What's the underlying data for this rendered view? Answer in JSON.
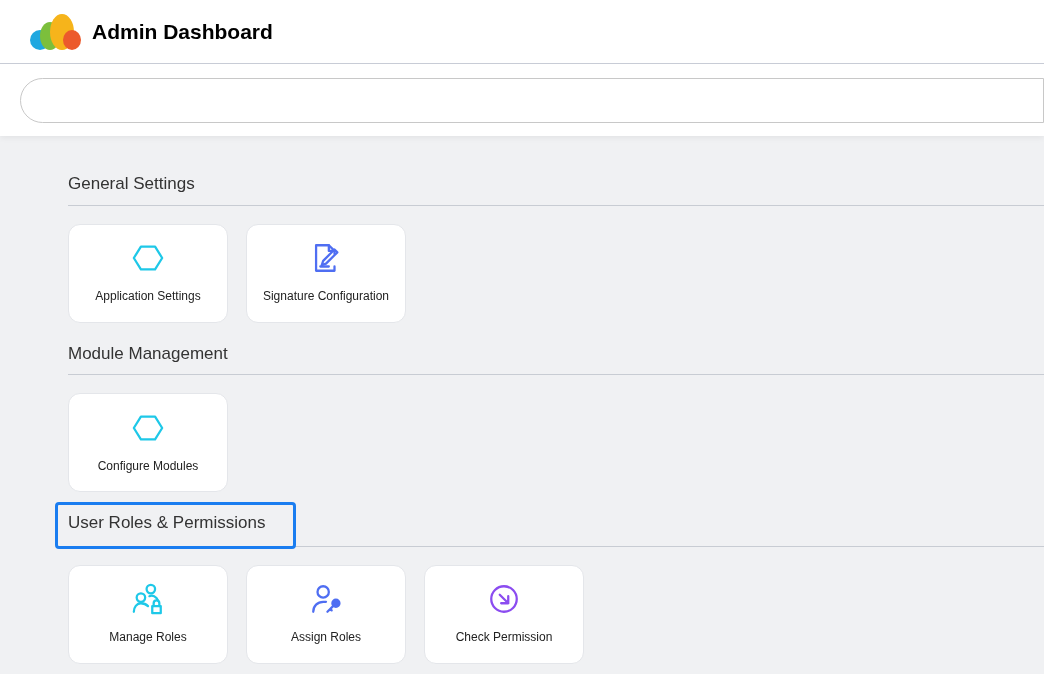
{
  "header": {
    "title": "Admin Dashboard"
  },
  "sections": [
    {
      "title": "General Settings",
      "highlighted": false,
      "tiles": [
        {
          "label": "Application Settings",
          "kind": "hexagon",
          "color": "#1ec8e8"
        },
        {
          "label": "Signature Configuration",
          "kind": "document-pen",
          "color": "#4f6ef2"
        }
      ]
    },
    {
      "title": "Module Management",
      "highlighted": false,
      "tiles": [
        {
          "label": "Configure Modules",
          "kind": "hexagon",
          "color": "#1ec8e8"
        }
      ]
    },
    {
      "title": "User Roles & Permissions",
      "highlighted": true,
      "tiles": [
        {
          "label": "Manage Roles",
          "kind": "users-lock",
          "color": "#1ec8e8"
        },
        {
          "label": "Assign Roles",
          "kind": "user-key",
          "color": "#4f6ef2"
        },
        {
          "label": "Check Permission",
          "kind": "arrow-circle",
          "color": "#8b4cf0"
        }
      ]
    }
  ]
}
